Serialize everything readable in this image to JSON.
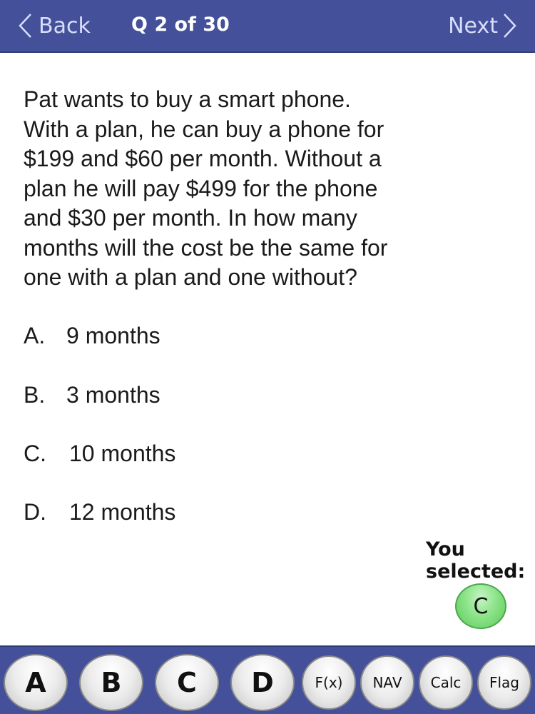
{
  "header": {
    "back_label": "Back",
    "question_counter": "Q 2 of 30",
    "next_label": "Next"
  },
  "question": {
    "lines": [
      "Pat wants to buy a smart phone.",
      "With a plan, he can buy a phone for",
      "$199 and $60 per month. Without a",
      "plan he will pay $499 for the phone",
      "and $30 per month. In how many",
      "months will the cost be the same for",
      "one with a plan and one without?"
    ]
  },
  "choices": [
    {
      "letter": "A.",
      "text": "9 months"
    },
    {
      "letter": "B.",
      "text": "3 months"
    },
    {
      "letter": "C.",
      "text": "10 months"
    },
    {
      "letter": "D.",
      "text": "12 months"
    }
  ],
  "selection": {
    "label_line1": "You",
    "label_line2": "selected:",
    "value": "C"
  },
  "toolbar": {
    "answer_buttons": [
      "A",
      "B",
      "C",
      "D"
    ],
    "tool_buttons": [
      "F(x)",
      "NAV",
      "Calc",
      "Flag"
    ]
  },
  "colors": {
    "bar_background": "#44519a",
    "selected_badge": "#8de48a"
  }
}
